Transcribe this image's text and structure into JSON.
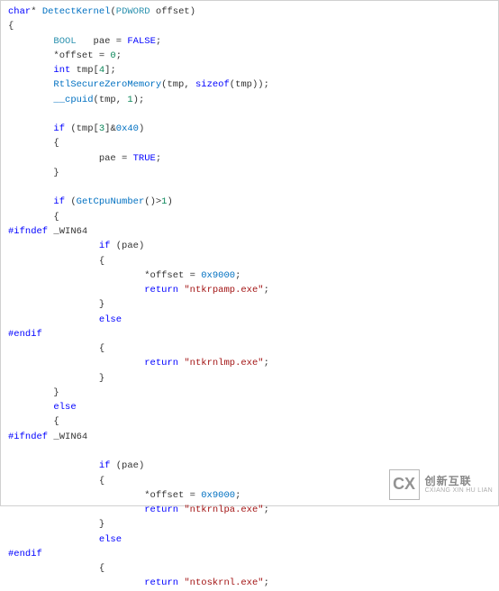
{
  "code": {
    "c0": {
      "kw": "char",
      "star": "*",
      "fn": "DetectKernel",
      "open": "(",
      "pt": "PDWORD",
      "arg": " offset)"
    },
    "c1": "{",
    "c2a": "        ",
    "c2_type": "BOOL",
    "c2b": "   pae = ",
    "c2_false": "FALSE",
    "c2c": ";",
    "c3a": "        *offset = ",
    "c3_zero": "0",
    "c3b": ";",
    "c4a": "        ",
    "c4_int": "int",
    "c4b": " tmp[",
    "c4_four": "4",
    "c4c": "];",
    "c5a": "        ",
    "c5_fn": "RtlSecureZeroMemory",
    "c5b": "(tmp, ",
    "c5_sz": "sizeof",
    "c5c": "(tmp));",
    "c6a": "        ",
    "c6_fn": "__cpuid",
    "c6b": "(tmp, ",
    "c6_one": "1",
    "c6c": ");",
    "blank": "",
    "c8a": "        ",
    "c8_if": "if",
    "c8b": " (tmp[",
    "c8_three": "3",
    "c8c": "]&",
    "c8_hex": "0x40",
    "c8d": ")",
    "c9": "        {",
    "c10a": "                pae = ",
    "c10_true": "TRUE",
    "c10b": ";",
    "c11": "        }",
    "c13a": "        ",
    "c13_if": "if",
    "c13b": " (",
    "c13_fn": "GetCpuNumber",
    "c13c": "()>",
    "c13_one": "1",
    "c13d": ")",
    "c14": "        {",
    "pp1a": "#ifndef",
    "pp1b": " _WIN64",
    "c16a": "                ",
    "c16_if": "if",
    "c16b": " (pae)",
    "c17": "                {",
    "c18a": "                        *offset = ",
    "c18_hex": "0x9000",
    "c18b": ";",
    "c19a": "                        ",
    "c19_ret": "return",
    "c19b": " ",
    "c19_str": "\"ntkrpamp.exe\"",
    "c19c": ";",
    "c20": "                }",
    "c21a": "                ",
    "c21_else": "else",
    "pp2": "#endif",
    "c23": "                {",
    "c24a": "                        ",
    "c24_ret": "return",
    "c24b": " ",
    "c24_str": "\"ntkrnlmp.exe\"",
    "c24c": ";",
    "c25": "                }",
    "c26": "        }",
    "c27a": "        ",
    "c27_else": "else",
    "c28": "        {",
    "pp3a": "#ifndef",
    "pp3b": " _WIN64",
    "c31a": "                ",
    "c31_if": "if",
    "c31b": " (pae)",
    "c32": "                {",
    "c33a": "                        *offset = ",
    "c33_hex": "0x9000",
    "c33b": ";",
    "c34a": "                        ",
    "c34_ret": "return",
    "c34b": " ",
    "c34_str": "\"ntkrnlpa.exe\"",
    "c34c": ";",
    "c35": "                }",
    "c36a": "                ",
    "c36_else": "else",
    "pp4": "#endif",
    "c38": "                {",
    "c39a": "                        ",
    "c39_ret": "return",
    "c39b": " ",
    "c39_str": "\"ntoskrnl.exe\"",
    "c39c": ";"
  },
  "watermark": {
    "logo": "CX",
    "cn": "创新互联",
    "en": "CXIANG XIN HU LIAN"
  }
}
